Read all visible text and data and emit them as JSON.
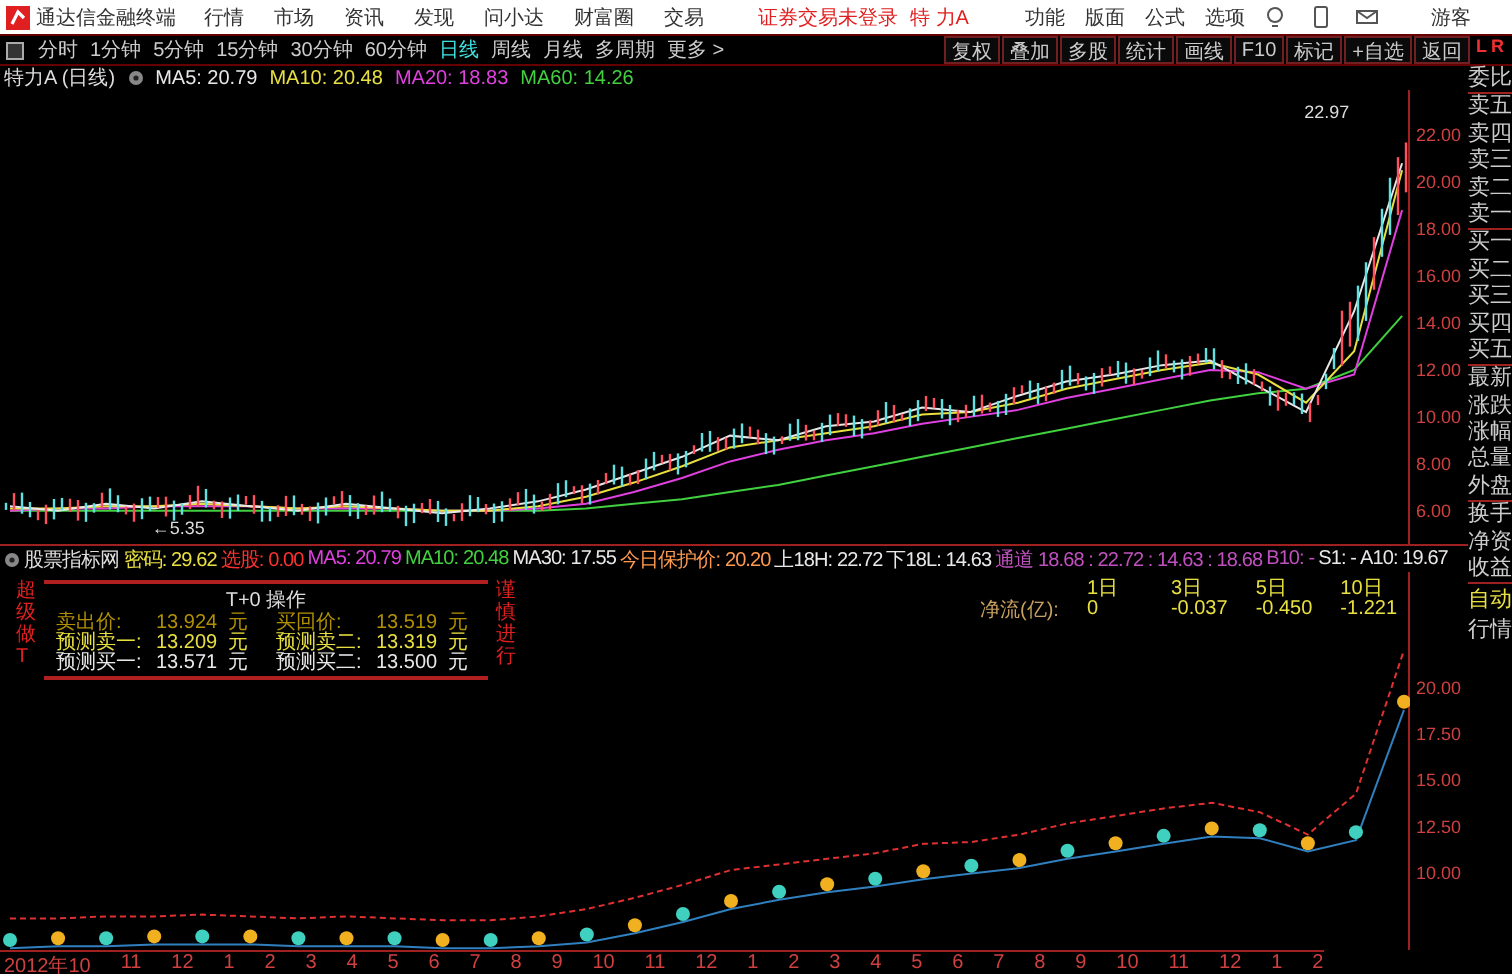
{
  "app_title": "通达信金融终端",
  "menus": [
    "行情",
    "市场",
    "资讯",
    "发现",
    "问小达",
    "财富圈",
    "交易"
  ],
  "login_status": "证券交易未登录",
  "stock_name": "特 力A",
  "right_menus": [
    "功能",
    "版面",
    "公式",
    "选项"
  ],
  "user": "游客",
  "periods": [
    {
      "label": "分时",
      "selected": false
    },
    {
      "label": "1分钟",
      "selected": false
    },
    {
      "label": "5分钟",
      "selected": false
    },
    {
      "label": "15分钟",
      "selected": false
    },
    {
      "label": "30分钟",
      "selected": false
    },
    {
      "label": "60分钟",
      "selected": false
    },
    {
      "label": "日线",
      "selected": true
    },
    {
      "label": "周线",
      "selected": false
    },
    {
      "label": "月线",
      "selected": false
    },
    {
      "label": "多周期",
      "selected": false
    },
    {
      "label": "更多 >",
      "selected": false
    }
  ],
  "tools": [
    "复权",
    "叠加",
    "多股",
    "统计",
    "画线",
    "F10",
    "标记",
    "+自选",
    "返回"
  ],
  "level_badge": {
    "left": "L",
    "right": "R"
  },
  "quote_title": {
    "name": "特力A (日线)",
    "mas": [
      {
        "label": "MA5: 20.79",
        "color": "#e8e8e8"
      },
      {
        "label": "MA10: 20.48",
        "color": "#e8e040"
      },
      {
        "label": "MA20: 18.83",
        "color": "#e040e0"
      },
      {
        "label": "MA60: 14.26",
        "color": "#40d040"
      }
    ]
  },
  "main_chart": {
    "chart_data": {
      "type": "line",
      "yticks": [
        {
          "value": 22,
          "label": "22.00"
        },
        {
          "value": 20,
          "label": "20.00"
        },
        {
          "value": 18,
          "label": "18.00"
        },
        {
          "value": 16,
          "label": "16.00"
        },
        {
          "value": 14,
          "label": "14.00"
        },
        {
          "value": 12,
          "label": "12.00"
        },
        {
          "value": 10,
          "label": "10.00"
        },
        {
          "value": 8,
          "label": "8.00"
        },
        {
          "value": 6,
          "label": "6.00"
        }
      ],
      "ylim": [
        4.6,
        23.9
      ],
      "series": [
        {
          "color": "#e8e8e8",
          "values": [
            6.2,
            6.0,
            6.3,
            6.1,
            6.4,
            6.2,
            6.0,
            6.3,
            6.1,
            5.9,
            6.1,
            6.4,
            6.9,
            7.6,
            8.3,
            9.2,
            9.0,
            9.6,
            9.8,
            10.4,
            10.2,
            10.9,
            11.5,
            11.8,
            12.2,
            12.4,
            11.3,
            10.2,
            14.5,
            20.8
          ]
        },
        {
          "color": "#e8e040",
          "values": [
            6.1,
            6.1,
            6.2,
            6.2,
            6.3,
            6.2,
            6.1,
            6.2,
            6.1,
            6.0,
            6.0,
            6.2,
            6.6,
            7.2,
            7.9,
            8.7,
            9.0,
            9.3,
            9.6,
            10.1,
            10.2,
            10.6,
            11.2,
            11.6,
            12.0,
            12.3,
            11.8,
            10.6,
            12.8,
            20.5
          ]
        },
        {
          "color": "#e040e0",
          "values": [
            6.0,
            6.1,
            6.1,
            6.2,
            6.2,
            6.2,
            6.1,
            6.1,
            6.1,
            6.0,
            6.0,
            6.1,
            6.3,
            6.8,
            7.4,
            8.1,
            8.6,
            9.0,
            9.3,
            9.7,
            10.0,
            10.3,
            10.8,
            11.2,
            11.6,
            12.0,
            11.9,
            11.2,
            11.8,
            18.8
          ]
        },
        {
          "color": "#40d040",
          "values": [
            6.0,
            6.0,
            6.0,
            6.0,
            6.0,
            6.0,
            6.0,
            6.0,
            6.0,
            6.0,
            6.0,
            6.0,
            6.1,
            6.3,
            6.5,
            6.8,
            7.1,
            7.5,
            7.9,
            8.3,
            8.7,
            9.1,
            9.5,
            9.9,
            10.3,
            10.7,
            11.0,
            11.2,
            12.0,
            14.3
          ]
        }
      ]
    },
    "high_mark": "22.97",
    "low_mark": "←5.35"
  },
  "indicator": {
    "name": "股票指标网",
    "items": [
      {
        "label": "密码:",
        "value": "29.62",
        "color": "#e8e040"
      },
      {
        "label": "选股:",
        "value": "0.00",
        "color": "#ff3030"
      },
      {
        "label": "MA5:",
        "value": "20.79",
        "color": "#e040e0"
      },
      {
        "label": "MA10:",
        "value": "20.48",
        "color": "#40d040"
      },
      {
        "label": "MA30:",
        "value": "17.55",
        "color": "#e8e8e8"
      },
      {
        "label": "今日保护价:",
        "value": "20.20",
        "color": "#ff9a50"
      },
      {
        "label": "上18H:",
        "value": "22.72",
        "color": "#e8e8e8"
      },
      {
        "label": "下18L:",
        "value": "14.63",
        "color": "#e8e8e8"
      },
      {
        "label": "通道",
        "value": "18.68 : 22.72 : 14.63 : 18.68",
        "color": "#c050c0"
      },
      {
        "label": "B10:",
        "value": "-",
        "color": "#c050c0"
      },
      {
        "label": "S1:",
        "value": "-",
        "color": "#e8e8e8"
      },
      {
        "label": "A10:",
        "value": "19.67",
        "color": "#e8e8e8"
      }
    ],
    "chart_data": {
      "type": "line",
      "yticks": [
        {
          "value": 20,
          "label": "20.00"
        },
        {
          "value": 17.5,
          "label": "17.50"
        },
        {
          "value": 15,
          "label": "15.00"
        },
        {
          "value": 12.5,
          "label": "12.50"
        },
        {
          "value": 10,
          "label": "10.00"
        }
      ],
      "ylim": [
        5.9,
        26.2
      ],
      "series": [
        {
          "color": "#e03030",
          "line_style": "dashed",
          "values": [
            7.6,
            7.6,
            7.7,
            7.7,
            7.8,
            7.7,
            7.6,
            7.7,
            7.6,
            7.5,
            7.5,
            7.7,
            8.1,
            8.7,
            9.4,
            10.2,
            10.5,
            10.8,
            11.1,
            11.6,
            11.7,
            12.1,
            12.7,
            13.1,
            13.5,
            13.8,
            13.3,
            12.1,
            14.3,
            22.0
          ]
        },
        {
          "color": "#3080c0",
          "values": [
            6.0,
            6.1,
            6.1,
            6.2,
            6.2,
            6.2,
            6.1,
            6.1,
            6.1,
            6.0,
            6.0,
            6.1,
            6.3,
            6.8,
            7.4,
            8.1,
            8.6,
            9.0,
            9.3,
            9.7,
            10.0,
            10.3,
            10.8,
            11.2,
            11.6,
            12.0,
            11.9,
            11.2,
            11.8,
            18.8
          ]
        }
      ]
    }
  },
  "t0_box": {
    "title": "T+0 操作",
    "left_tag": "超级做T",
    "right_tag": "谨慎进行",
    "rows": [
      {
        "color": "#b09000",
        "cells": [
          {
            "label": "卖出价:",
            "value": "13.924",
            "unit": "元"
          },
          {
            "label": "买回价:",
            "value": "13.519",
            "unit": "元"
          }
        ]
      },
      {
        "color": "#e8e040",
        "cells": [
          {
            "label": "预测卖一:",
            "value": "13.209",
            "unit": "元"
          },
          {
            "label": "预测卖二:",
            "value": "13.319",
            "unit": "元"
          }
        ]
      },
      {
        "color": "#e8e8e8",
        "cells": [
          {
            "label": "预测买一:",
            "value": "13.571",
            "unit": "元"
          },
          {
            "label": "预测买二:",
            "value": "13.500",
            "unit": "元"
          }
        ]
      }
    ]
  },
  "net_flow": {
    "label": "净流(亿):",
    "columns": [
      {
        "period": "1日",
        "value": "0"
      },
      {
        "period": "3日",
        "value": "-0.037"
      },
      {
        "period": "5日",
        "value": "-0.450"
      },
      {
        "period": "10日",
        "value": "-1.221"
      }
    ]
  },
  "x_axis": [
    "2012年10",
    "11",
    "12",
    "1",
    "2",
    "3",
    "4",
    "5",
    "6",
    "7",
    "8",
    "9",
    "10",
    "11",
    "12",
    "1",
    "2",
    "3",
    "4",
    "5",
    "6",
    "7",
    "8",
    "9",
    "10",
    "11",
    "12",
    "1",
    "2"
  ],
  "quote_panel": [
    [
      "委比"
    ],
    [
      "卖五",
      "卖四",
      "卖三",
      "卖二",
      "卖一"
    ],
    [
      "买一",
      "买二",
      "买三",
      "买四",
      "买五"
    ],
    [
      "最新",
      "涨跌",
      "涨幅",
      "总量",
      "外盘"
    ],
    [
      "换手",
      "净资",
      "收益"
    ]
  ],
  "bottom_tabs": [
    "自动",
    "行情"
  ]
}
